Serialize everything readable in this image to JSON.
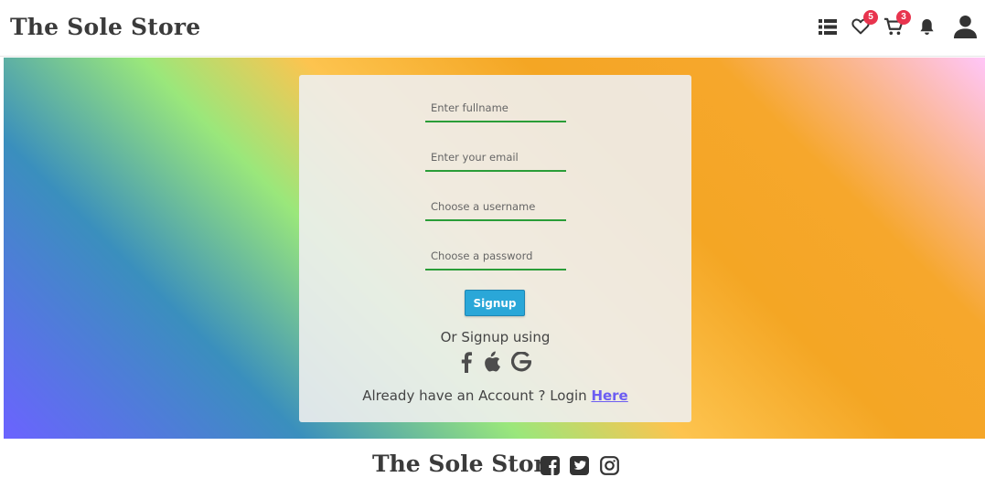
{
  "header": {
    "brand": "The Sole Store",
    "wishlist_count": "5",
    "cart_count": "3",
    "icons": [
      "list-icon",
      "heart-icon",
      "cart-icon",
      "bell-icon",
      "user-icon"
    ]
  },
  "form": {
    "fullname_placeholder": "Enter fullname",
    "email_placeholder": "Enter your email",
    "username_placeholder": "Choose a username",
    "password_placeholder": "Choose a password",
    "fullname_value": "",
    "email_value": "",
    "username_value": "",
    "password_value": "",
    "signup_label": "Signup",
    "or_text": "Or Signup using",
    "social_icons": [
      "facebook-icon",
      "apple-icon",
      "google-icon"
    ],
    "login_prompt": "Already have an Account ? Login",
    "login_link": "Here"
  },
  "footer": {
    "brand": "The Sole Store",
    "icons": [
      "facebook-square-icon",
      "twitter-square-icon",
      "instagram-icon"
    ]
  },
  "colors": {
    "accent_underline": "#2a9d38",
    "button": "#2aa7d8",
    "badge": "#e8344e",
    "link": "#6c5df2"
  }
}
